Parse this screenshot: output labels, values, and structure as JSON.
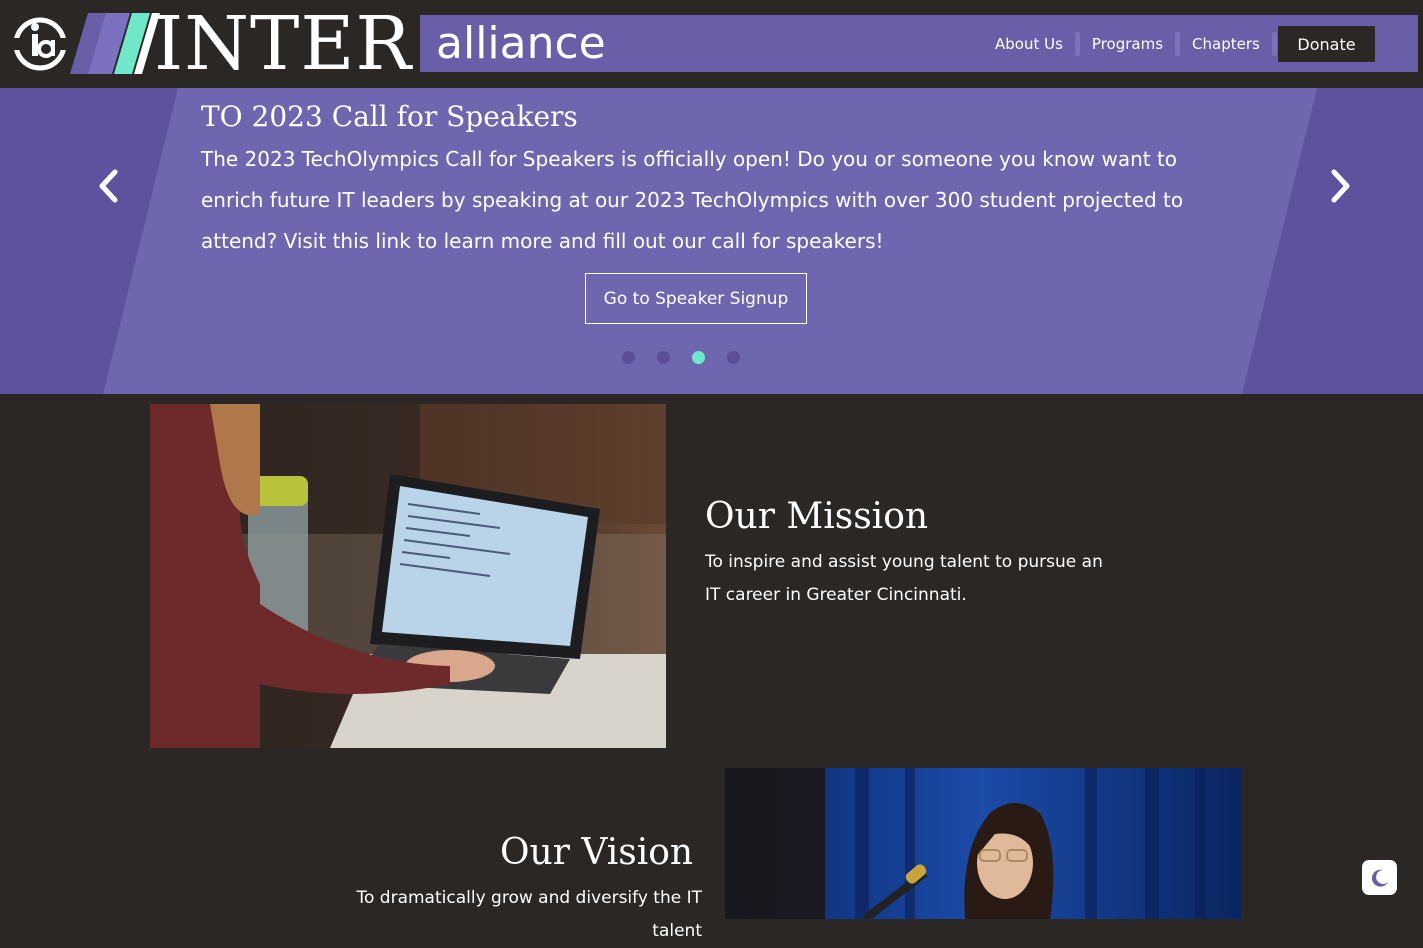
{
  "header": {
    "logo_letters": "ia",
    "wordmark_main": "INTER",
    "wordmark_sub": "alliance",
    "nav": [
      {
        "label": "About Us"
      },
      {
        "label": "Programs"
      },
      {
        "label": "Chapters"
      }
    ],
    "donate_label": "Donate"
  },
  "hero": {
    "title": "TO 2023 Call for Speakers",
    "text": "The 2023 TechOlympics Call for Speakers is officially open! Do you or someone you know want to enrich future IT leaders by speaking at our 2023 TechOlympics with over 300 student projected to attend? Visit this link to learn more and fill out our call for speakers!",
    "button_label": "Go to Speaker Signup",
    "slide_count": 4,
    "active_slide": 3,
    "prev_icon": "chevron-left-icon",
    "next_icon": "chevron-right-icon"
  },
  "mission": {
    "heading": "Our Mission",
    "text": "To inspire and assist young talent to pursue an IT career in Greater Cincinnati."
  },
  "vision": {
    "heading": "Our Vision",
    "text": "To dramatically grow and diversify the IT talent"
  },
  "theme_toggle": {
    "icon": "moon-icon"
  },
  "colors": {
    "background": "#2b2724",
    "brand_purple": "#6a5ea8",
    "accent_mint": "#6ee8c8"
  }
}
